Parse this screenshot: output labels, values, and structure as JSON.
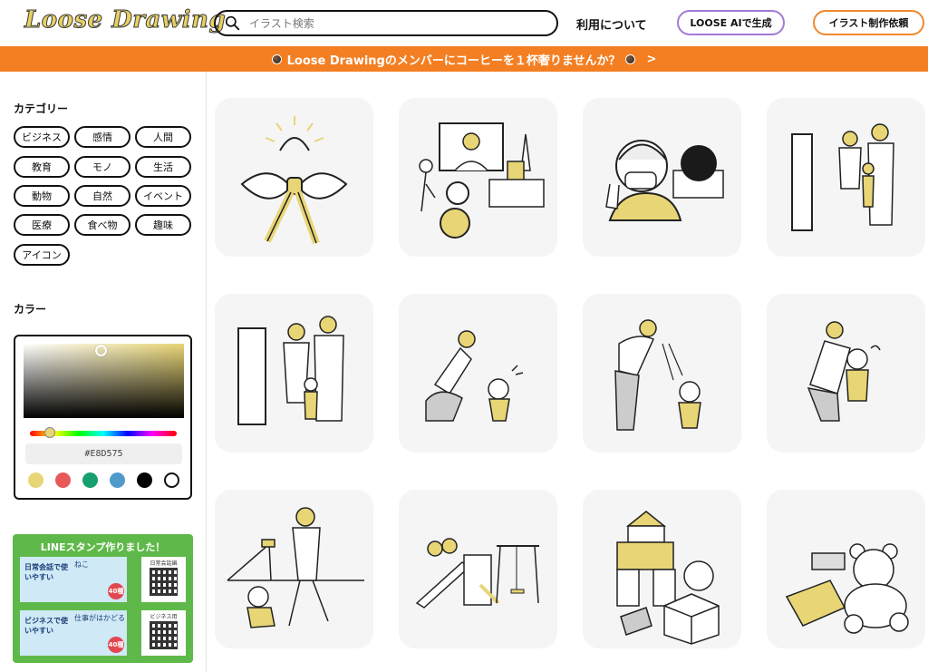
{
  "header": {
    "logo": "Loose Drawing",
    "search_placeholder": "イラスト検索",
    "about_label": "利用について",
    "ai_button_label": "LOOSE AIで生成",
    "request_button_label": "イラスト制作依頼"
  },
  "banner": {
    "text": "Loose Drawingのメンバーにコーヒーを１杯奢りませんか？",
    "arrow": ">"
  },
  "sidebar": {
    "category_title": "カテゴリー",
    "categories": [
      "ビジネス",
      "感情",
      "人間",
      "教育",
      "モノ",
      "生活",
      "動物",
      "自然",
      "イベント",
      "医療",
      "食べ物",
      "趣味",
      "アイコン"
    ],
    "color_title": "カラー",
    "color_picker": {
      "hex_value": "#E8D575",
      "hue_position": 0.13,
      "swatches": [
        "#e8d575",
        "#e85a5a",
        "#16a06e",
        "#4f9ac8",
        "#000000",
        "#ffffff"
      ]
    },
    "line_promo": {
      "title": "LINEスタンプ作りました！",
      "stamps": [
        {
          "text": "日常会話で使いやすい",
          "sub": "ねこ",
          "badge": "40種",
          "qr_label": "日常会話編"
        },
        {
          "text": "ビジネスで使いやすい",
          "sub": "仕事がはかどる",
          "badge": "40種",
          "qr_label": "ビジネス用"
        }
      ]
    }
  },
  "illustrations": [
    {
      "name": "ribbon-sunrise"
    },
    {
      "name": "tv-city-robot"
    },
    {
      "name": "mask-peace-sign"
    },
    {
      "name": "family-at-gate"
    },
    {
      "name": "family-at-door"
    },
    {
      "name": "mother-child-walking"
    },
    {
      "name": "parent-scolding-child"
    },
    {
      "name": "mother-hugging-child"
    },
    {
      "name": "park-father-toddler"
    },
    {
      "name": "playground-equipment"
    },
    {
      "name": "toy-blocks"
    },
    {
      "name": "teddy-bear-toys"
    }
  ],
  "colors": {
    "accent_yellow": "#e8d575",
    "banner_orange": "#f47f22",
    "ai_purple": "#a37ad6",
    "request_orange": "#f0892f",
    "line_green": "#5fb94a"
  }
}
